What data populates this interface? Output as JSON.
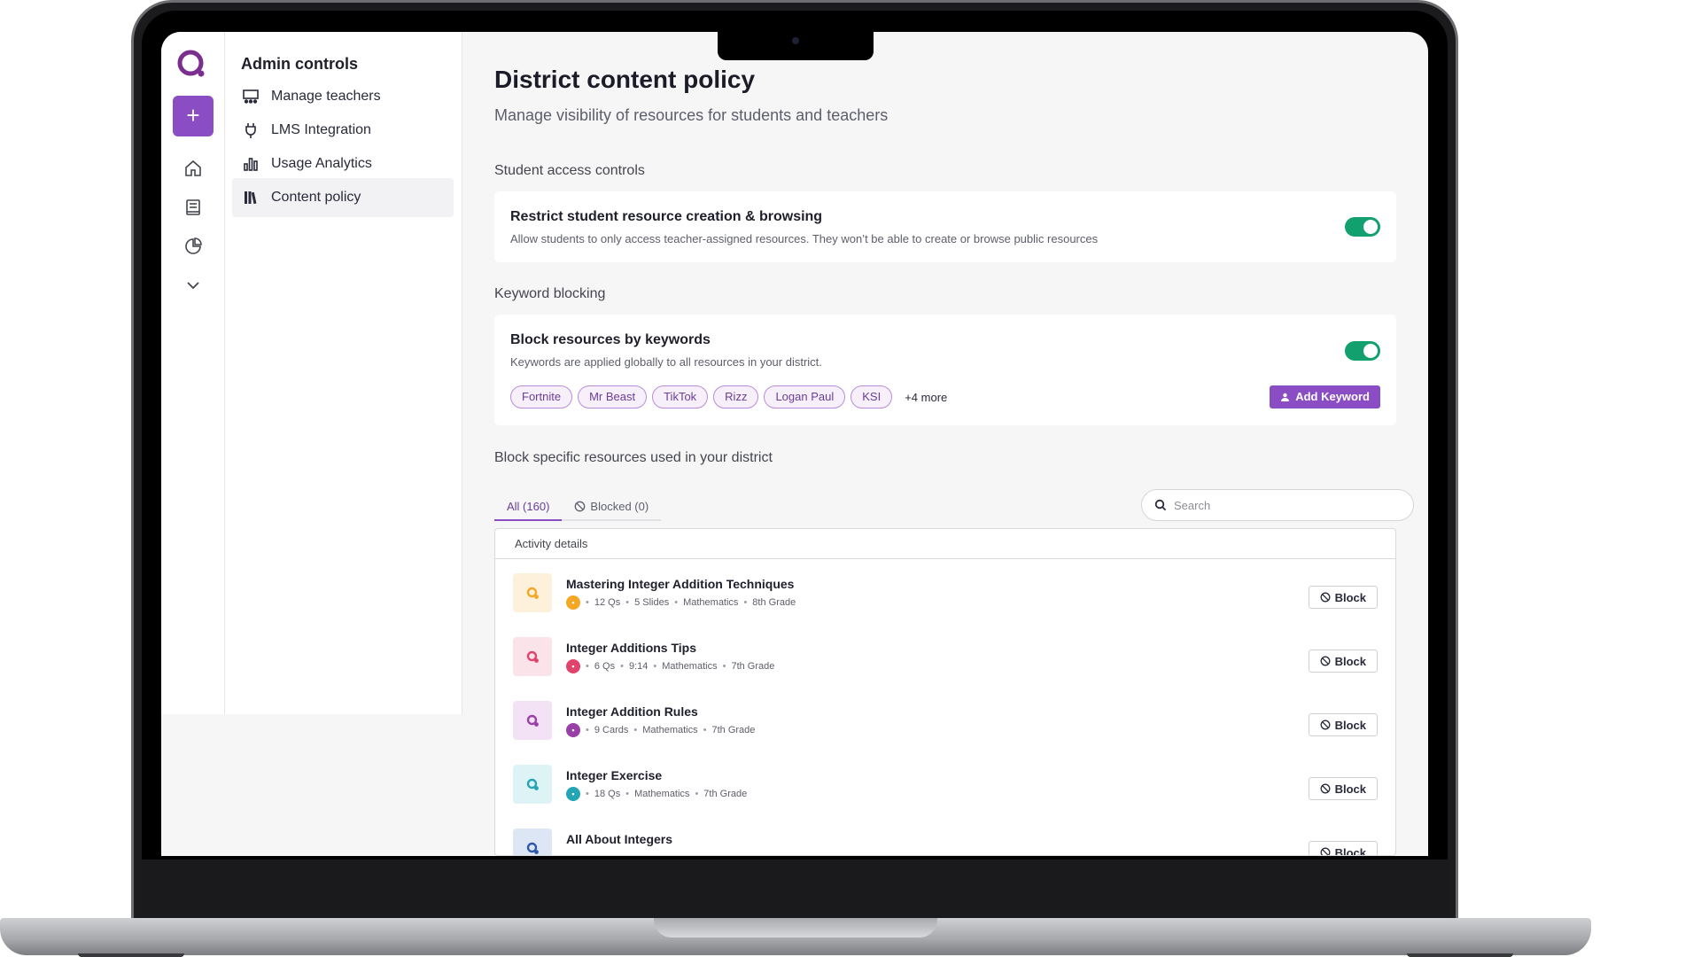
{
  "sidebar": {
    "title": "Admin controls",
    "items": [
      {
        "label": "Manage teachers",
        "icon": "teachers-grid-icon"
      },
      {
        "label": "LMS Integration",
        "icon": "plug-icon"
      },
      {
        "label": "Usage Analytics",
        "icon": "bar-chart-icon"
      },
      {
        "label": "Content policy",
        "icon": "library-icon",
        "active": true
      }
    ]
  },
  "rail": {
    "add_label": "+",
    "icons": [
      "home-icon",
      "book-icon",
      "pie-chart-icon",
      "chevron-down-icon"
    ]
  },
  "header": {
    "title": "District content policy",
    "subtitle": "Manage visibility of resources for students and teachers"
  },
  "student_access": {
    "section_label": "Student access controls",
    "title": "Restrict student resource creation & browsing",
    "description": "Allow students to only access teacher-assigned resources. They won’t be able to create or browse public resources",
    "enabled": true
  },
  "keyword_blocking": {
    "section_label": "Keyword blocking",
    "title": "Block resources by keywords",
    "description": "Keywords are applied globally to all resources in your district.",
    "enabled": true,
    "keywords": [
      "Fortnite",
      "Mr Beast",
      "TikTok",
      "Rizz",
      "Logan Paul",
      "KSI"
    ],
    "more_label": "+4 more",
    "add_button": "Add Keyword"
  },
  "resources": {
    "section_label": "Block specific resources used in your district",
    "tabs": [
      {
        "label": "All (160)",
        "active": true
      },
      {
        "label": "Blocked (0)",
        "active": false
      }
    ],
    "search_placeholder": "Search",
    "table_header": "Activity details",
    "block_label": "Block",
    "rows": [
      {
        "title": "Mastering Integer Addition Techniques",
        "meta": [
          "12 Qs",
          "5 Slides",
          "Mathematics",
          "8th Grade"
        ],
        "color": "#f5a623",
        "thumb_bg": "#fdf1dc"
      },
      {
        "title": "Integer Additions Tips",
        "meta": [
          "6 Qs",
          "9:14",
          "Mathematics",
          "7th Grade"
        ],
        "color": "#e0436b",
        "thumb_bg": "#fbe3ea"
      },
      {
        "title": "Integer Addition Rules",
        "meta": [
          "9 Cards",
          "Mathematics",
          "7th Grade"
        ],
        "color": "#9b3fa8",
        "thumb_bg": "#f3e2f5"
      },
      {
        "title": "Integer Exercise",
        "meta": [
          "18 Qs",
          "Mathematics",
          "7th Grade"
        ],
        "color": "#23a5b5",
        "thumb_bg": "#def3f6"
      },
      {
        "title": "All About Integers",
        "meta": [],
        "color": "#2d5aa8",
        "thumb_bg": "#dde6f5"
      }
    ]
  },
  "colors": {
    "accent": "#8b4dc4",
    "toggle_on": "#12a06e"
  }
}
